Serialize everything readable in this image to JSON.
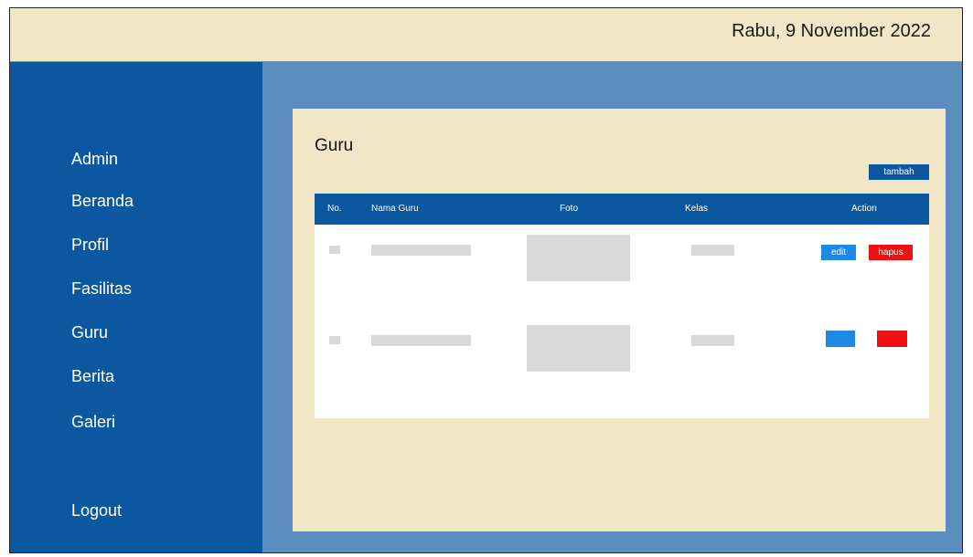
{
  "header": {
    "date": "Rabu, 9 November 2022"
  },
  "sidebar": {
    "items": [
      {
        "label": "Admin"
      },
      {
        "label": "Beranda"
      },
      {
        "label": "Profil"
      },
      {
        "label": "Fasilitas"
      },
      {
        "label": "Guru"
      },
      {
        "label": "Berita"
      },
      {
        "label": "Galeri"
      }
    ],
    "logout": "Logout"
  },
  "main": {
    "title": "Guru",
    "add_label": "tambah",
    "table": {
      "columns": [
        "No.",
        "Nama Guru",
        "Foto",
        "Kelas",
        "Action"
      ],
      "rows": [
        {
          "edit_label": "edit",
          "delete_label": "hapus"
        },
        {
          "edit_label": "",
          "delete_label": ""
        }
      ]
    }
  },
  "colors": {
    "sidebar": "#0b57a0",
    "background": "#5b8ebf",
    "panel": "#f1e7c6",
    "edit": "#1e88e5",
    "delete": "#ee1111"
  }
}
